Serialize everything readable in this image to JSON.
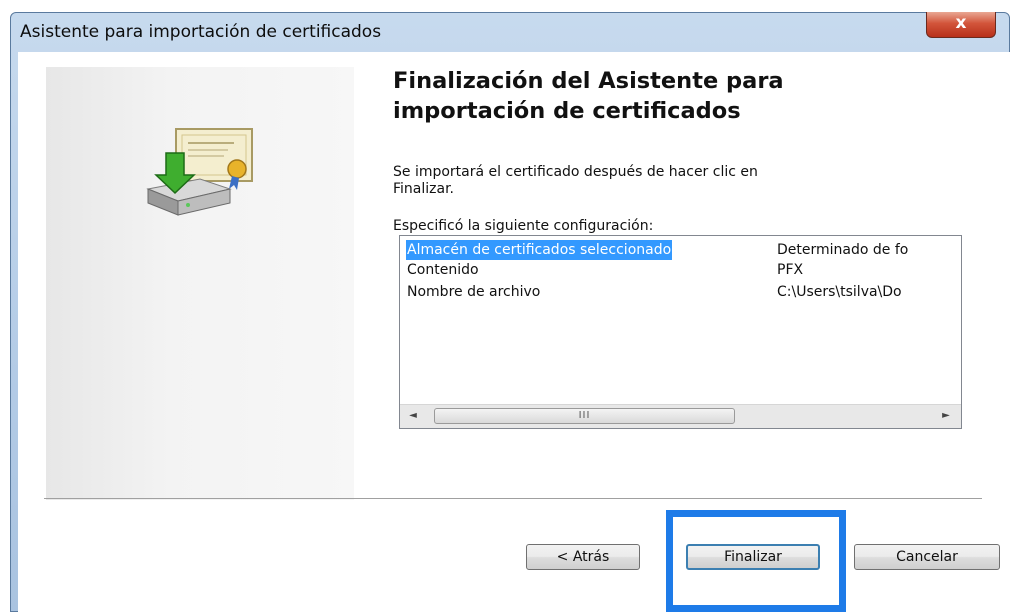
{
  "window": {
    "title": "Asistente para importación de certificados",
    "close_glyph": "x"
  },
  "heading": {
    "line1": "Finalización del Asistente para",
    "line2": "importación de certificados"
  },
  "description": {
    "line1": "Se importará el certificado después de hacer clic en",
    "line2": "Finalizar."
  },
  "spec_label": "Especificó la siguiente configuración:",
  "settings": [
    {
      "name": "Almacén de certificados seleccionado",
      "value": "Determinado de fo"
    },
    {
      "name": "Contenido",
      "value": "PFX"
    },
    {
      "name": "Nombre de archivo",
      "value": "C:\\Users\\tsilva\\Do"
    }
  ],
  "scrollbar": {
    "left_arrow": "◄",
    "right_arrow": "►",
    "thumb_grip": "III"
  },
  "buttons": {
    "back": "< Atrás",
    "finish": "Finalizar",
    "cancel": "Cancelar"
  },
  "colors": {
    "selection": "#3399ff",
    "highlight_box": "#1e7be8",
    "close_button": "#c9432a"
  }
}
